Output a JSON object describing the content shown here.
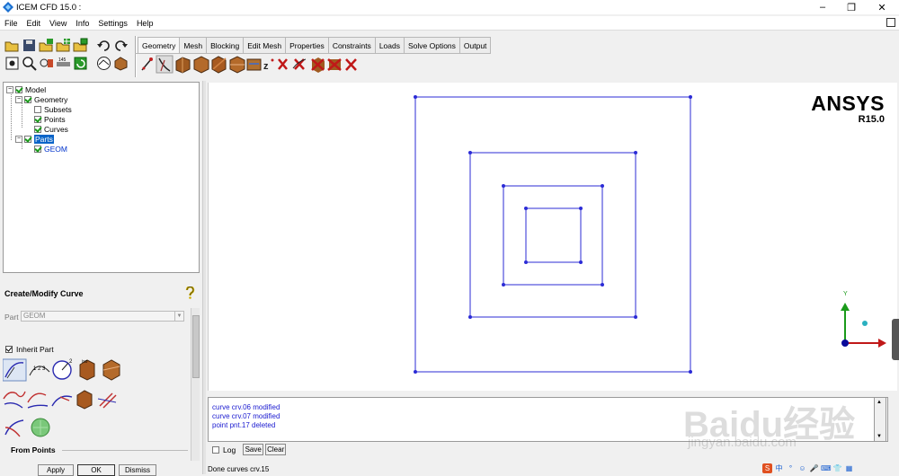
{
  "window": {
    "title": "ICEM CFD 15.0 :",
    "minimize": "–",
    "restore": "❐",
    "close": "✕"
  },
  "menu": {
    "items": [
      "File",
      "Edit",
      "View",
      "Info",
      "Settings",
      "Help"
    ]
  },
  "tabs": [
    "Geometry",
    "Mesh",
    "Blocking",
    "Edit Mesh",
    "Properties",
    "Constraints",
    "Loads",
    "Solve Options",
    "Output"
  ],
  "active_tab": "Geometry",
  "tree": {
    "model": "Model",
    "geometry": "Geometry",
    "subsets": "Subsets",
    "points": "Points",
    "curves": "Curves",
    "parts": "Parts",
    "geom": "GEOM"
  },
  "panel": {
    "title": "Create/Modify Curve",
    "part_label": "Part",
    "part_value": "GEOM",
    "inherit_label": "Inherit Part",
    "from_points": "From Points",
    "apply": "Apply",
    "ok": "OK",
    "dismiss": "Dismiss"
  },
  "viewport": {
    "brand": "ANSYS",
    "version": "R15.0",
    "axis_y": "Y",
    "curve_color": "#2b2bd6"
  },
  "log": {
    "lines": [
      "curve crv.06 modified",
      "curve crv.07 modified",
      "point pnt.17 deleted"
    ],
    "log_label": "Log",
    "save": "Save",
    "clear": "Clear"
  },
  "status": "Done curves crv.15",
  "watermark": {
    "text": "Baidu经验",
    "url": "jingyan.baidu.com"
  },
  "tray": {
    "items": [
      "S",
      "中",
      "°",
      "☺",
      "🎤",
      "⌨",
      "👕",
      "▦"
    ]
  }
}
